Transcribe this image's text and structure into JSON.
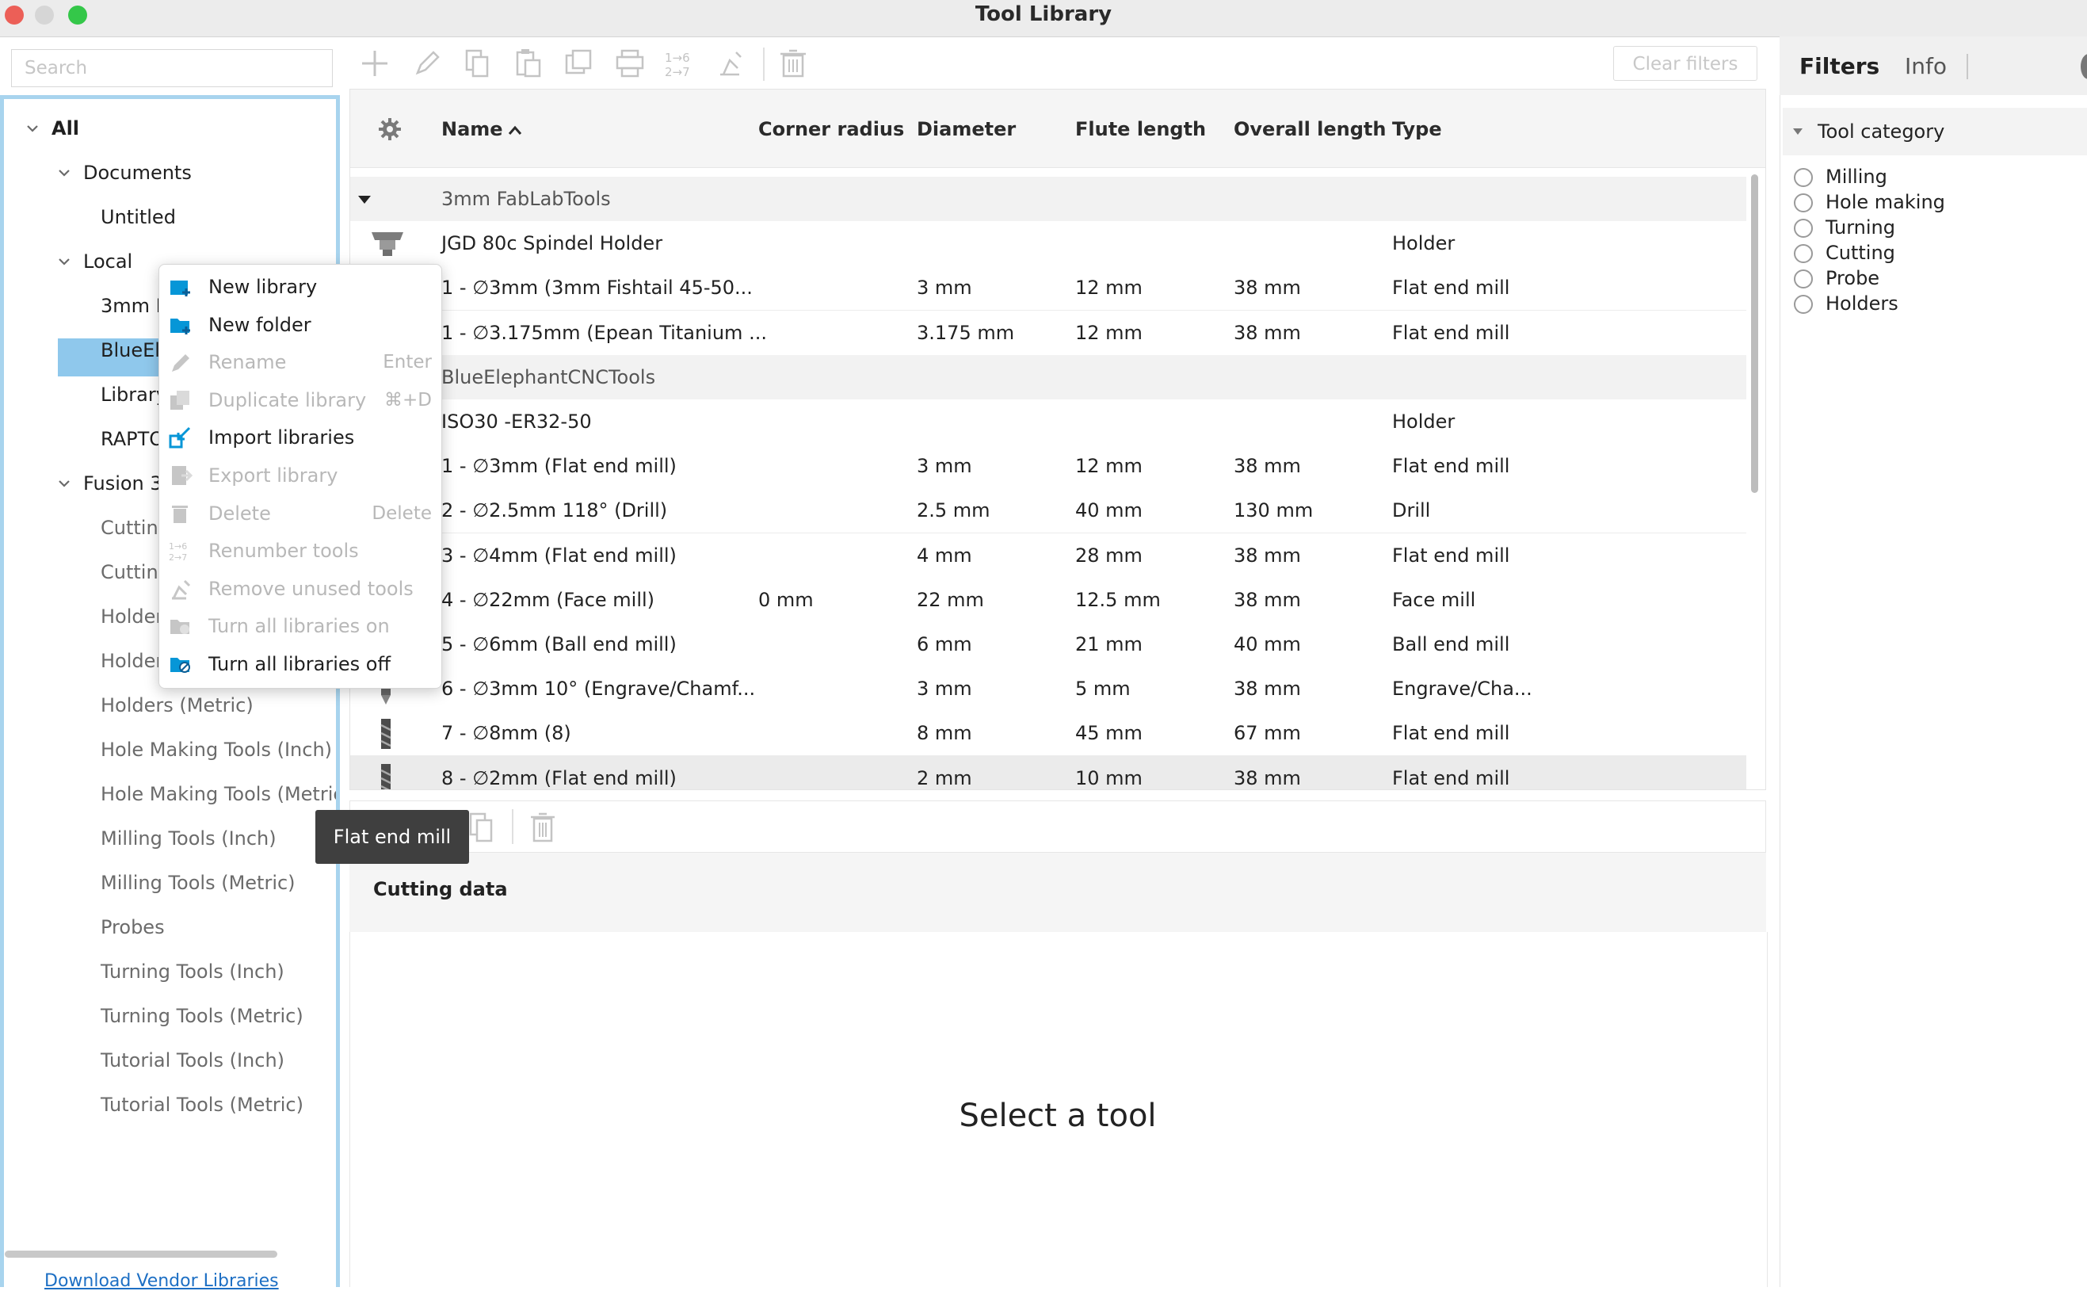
{
  "window": {
    "title": "Tool Library"
  },
  "left": {
    "search_placeholder": "Search",
    "tree": [
      {
        "label": "All",
        "bold": true
      },
      {
        "label": "Documents"
      },
      {
        "label": "Untitled"
      },
      {
        "label": "Local"
      },
      {
        "label": "3mm Fa"
      },
      {
        "label": "BlueEle"
      },
      {
        "label": "Library"
      },
      {
        "label": "RAPTOI"
      },
      {
        "label": "Fusion 36"
      },
      {
        "label": "Cutting"
      },
      {
        "label": "Cutting"
      },
      {
        "label": "Holder:"
      },
      {
        "label": "Holder:"
      },
      {
        "label": "Holders (Metric)"
      },
      {
        "label": "Hole Making Tools (Inch)"
      },
      {
        "label": "Hole Making Tools (Metric"
      },
      {
        "label": "Milling Tools (Inch)"
      },
      {
        "label": "Milling Tools (Metric)"
      },
      {
        "label": "Probes"
      },
      {
        "label": "Turning Tools (Inch)"
      },
      {
        "label": "Turning Tools (Metric)"
      },
      {
        "label": "Tutorial Tools (Inch)"
      },
      {
        "label": "Tutorial Tools (Metric)"
      }
    ],
    "vendor_link": "Download Vendor Libraries"
  },
  "toolbar": {
    "clear_filters": "Clear filters"
  },
  "table": {
    "headers": {
      "name": "Name",
      "corner_radius": "Corner radius",
      "diameter": "Diameter",
      "flute_length": "Flute length",
      "overall_length": "Overall length",
      "type": "Type"
    },
    "sort_icon": "caret-up-icon",
    "rows": [
      {
        "group": true,
        "name": "3mm FabLabTools"
      },
      {
        "name": "JGD 80c Spindel Holder",
        "corner_radius": "",
        "diameter": "",
        "flute_length": "",
        "overall_length": "",
        "type": "Holder",
        "icon": "holder"
      },
      {
        "name": "1 - ∅3mm (3mm Fishtail 45-50...",
        "corner_radius": "",
        "diameter": "3 mm",
        "flute_length": "12 mm",
        "overall_length": "38 mm",
        "type": "Flat end mill",
        "icon": "mill"
      },
      {
        "name": "1 - ∅3.175mm (Epean Titanium ...",
        "corner_radius": "",
        "diameter": "3.175 mm",
        "flute_length": "12 mm",
        "overall_length": "38 mm",
        "type": "Flat end mill",
        "icon": "mill"
      },
      {
        "group": true,
        "name": "BlueElephantCNCTools"
      },
      {
        "name": "ISO30 -ER32-50",
        "corner_radius": "",
        "diameter": "",
        "flute_length": "",
        "overall_length": "",
        "type": "Holder",
        "icon": "holder"
      },
      {
        "name": "1 - ∅3mm (Flat end mill)",
        "corner_radius": "",
        "diameter": "3 mm",
        "flute_length": "12 mm",
        "overall_length": "38 mm",
        "type": "Flat end mill",
        "icon": "mill"
      },
      {
        "name": "2 - ∅2.5mm 118° (Drill)",
        "corner_radius": "",
        "diameter": "2.5 mm",
        "flute_length": "40 mm",
        "overall_length": "130 mm",
        "type": "Drill",
        "icon": "drill"
      },
      {
        "name": "3 - ∅4mm (Flat end mill)",
        "corner_radius": "",
        "diameter": "4 mm",
        "flute_length": "28 mm",
        "overall_length": "38 mm",
        "type": "Flat end mill",
        "icon": "mill"
      },
      {
        "name": "4 - ∅22mm (Face mill)",
        "corner_radius": "0 mm",
        "diameter": "22 mm",
        "flute_length": "12.5 mm",
        "overall_length": "38 mm",
        "type": "Face mill",
        "icon": "face"
      },
      {
        "name": "5 - ∅6mm (Ball end mill)",
        "corner_radius": "",
        "diameter": "6 mm",
        "flute_length": "21 mm",
        "overall_length": "40 mm",
        "type": "Ball end mill",
        "icon": "mill"
      },
      {
        "name": "6 - ∅3mm 10° (Engrave/Chamf...",
        "corner_radius": "",
        "diameter": "3 mm",
        "flute_length": "5 mm",
        "overall_length": "38 mm",
        "type": "Engrave/Cha...",
        "icon": "engrave"
      },
      {
        "name": "7 - ∅8mm (8)",
        "corner_radius": "",
        "diameter": "8 mm",
        "flute_length": "45 mm",
        "overall_length": "67 mm",
        "type": "Flat end mill",
        "icon": "mill"
      },
      {
        "name": "8 - ∅2mm (Flat end mill)",
        "corner_radius": "",
        "diameter": "2 mm",
        "flute_length": "10 mm",
        "overall_length": "38 mm",
        "type": "Flat end mill",
        "icon": "mill",
        "highlight": true
      }
    ]
  },
  "tooltip": "Flat end mill",
  "cutting_data": {
    "label": "Cutting data"
  },
  "detail": {
    "placeholder": "Select a tool"
  },
  "right": {
    "tabs": [
      "Filters",
      "Info"
    ],
    "category_header": "Tool category",
    "categories": [
      "Milling",
      "Hole making",
      "Turning",
      "Cutting",
      "Probe",
      "Holders"
    ]
  },
  "context_menu": [
    {
      "label": "New library",
      "shortcut": "",
      "enabled": true,
      "icon": "new-library-icon"
    },
    {
      "label": "New folder",
      "shortcut": "",
      "enabled": true,
      "icon": "new-folder-icon"
    },
    {
      "label": "Rename",
      "shortcut": "Enter",
      "enabled": false,
      "icon": "rename-icon"
    },
    {
      "label": "Duplicate library",
      "shortcut": "⌘+D",
      "enabled": false,
      "icon": "duplicate-icon"
    },
    {
      "label": "Import libraries",
      "shortcut": "",
      "enabled": true,
      "icon": "import-icon"
    },
    {
      "label": "Export library",
      "shortcut": "",
      "enabled": false,
      "icon": "export-icon"
    },
    {
      "label": "Delete",
      "shortcut": "Delete",
      "enabled": false,
      "icon": "delete-icon"
    },
    {
      "label": "Renumber tools",
      "shortcut": "",
      "enabled": false,
      "icon": "renumber-icon"
    },
    {
      "label": "Remove unused tools",
      "shortcut": "",
      "enabled": false,
      "icon": "remove-unused-icon"
    },
    {
      "label": "Turn all libraries on",
      "shortcut": "",
      "enabled": false,
      "icon": "libraries-on-icon"
    },
    {
      "label": "Turn all libraries off",
      "shortcut": "",
      "enabled": true,
      "icon": "libraries-off-icon"
    }
  ],
  "colors": {
    "accent": "#0696d7",
    "selection": "#8fc8ec",
    "tree_border": "#a8d4ee"
  }
}
